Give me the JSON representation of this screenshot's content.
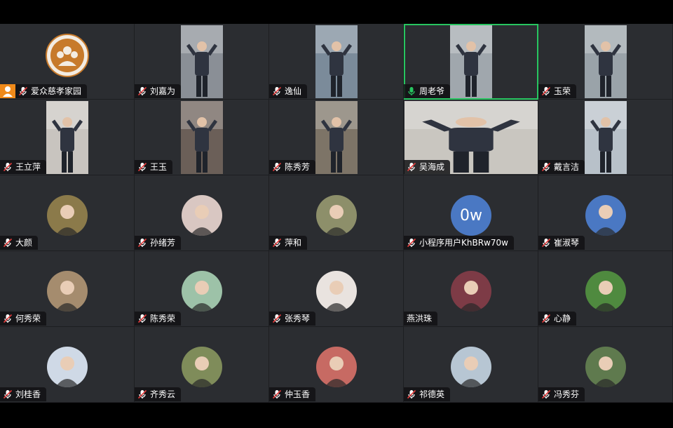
{
  "colors": {
    "active_border": "#27c560",
    "host_badge": "#f08a1a",
    "tile_bg": "#2b2d31",
    "text_avatar_bg": "#4a78c3"
  },
  "participants": [
    {
      "name": "爱众慈孝家园",
      "kind": "logo",
      "mic": "muted",
      "host": true
    },
    {
      "name": "刘嘉为",
      "kind": "video",
      "mic": "muted"
    },
    {
      "name": "逸仙",
      "kind": "video",
      "mic": "muted"
    },
    {
      "name": "周老爷",
      "kind": "video",
      "mic": "active",
      "active": true
    },
    {
      "name": "玉荣",
      "kind": "video",
      "mic": "muted"
    },
    {
      "name": "王立萍",
      "kind": "video",
      "mic": "muted"
    },
    {
      "name": "王玉",
      "kind": "video",
      "mic": "muted"
    },
    {
      "name": "陈秀芳",
      "kind": "video",
      "mic": "muted"
    },
    {
      "name": "吴海成",
      "kind": "video-wide",
      "mic": "muted"
    },
    {
      "name": "戴言洁",
      "kind": "video",
      "mic": "muted"
    },
    {
      "name": "大颜",
      "kind": "avatar",
      "mic": "muted"
    },
    {
      "name": "孙绪芳",
      "kind": "avatar",
      "mic": "muted"
    },
    {
      "name": "萍和",
      "kind": "avatar",
      "mic": "muted"
    },
    {
      "name": "小程序用户KhBRw70w",
      "kind": "text-avatar",
      "avatar_text": "0w",
      "mic": "muted"
    },
    {
      "name": "崔淑琴",
      "kind": "avatar",
      "mic": "muted"
    },
    {
      "name": "何秀荣",
      "kind": "avatar",
      "mic": "muted"
    },
    {
      "name": "陈秀荣",
      "kind": "avatar",
      "mic": "muted"
    },
    {
      "name": "张秀琴",
      "kind": "avatar",
      "mic": "muted"
    },
    {
      "name": "燕洪珠",
      "kind": "avatar",
      "mic": "none"
    },
    {
      "name": "心静",
      "kind": "avatar",
      "mic": "muted"
    },
    {
      "name": "刘桂香",
      "kind": "avatar",
      "mic": "muted"
    },
    {
      "name": "齐秀云",
      "kind": "avatar",
      "mic": "muted"
    },
    {
      "name": "仲玉香",
      "kind": "avatar",
      "mic": "muted"
    },
    {
      "name": "祁德英",
      "kind": "avatar",
      "mic": "muted"
    },
    {
      "name": "冯秀芬",
      "kind": "avatar",
      "mic": "muted"
    }
  ]
}
